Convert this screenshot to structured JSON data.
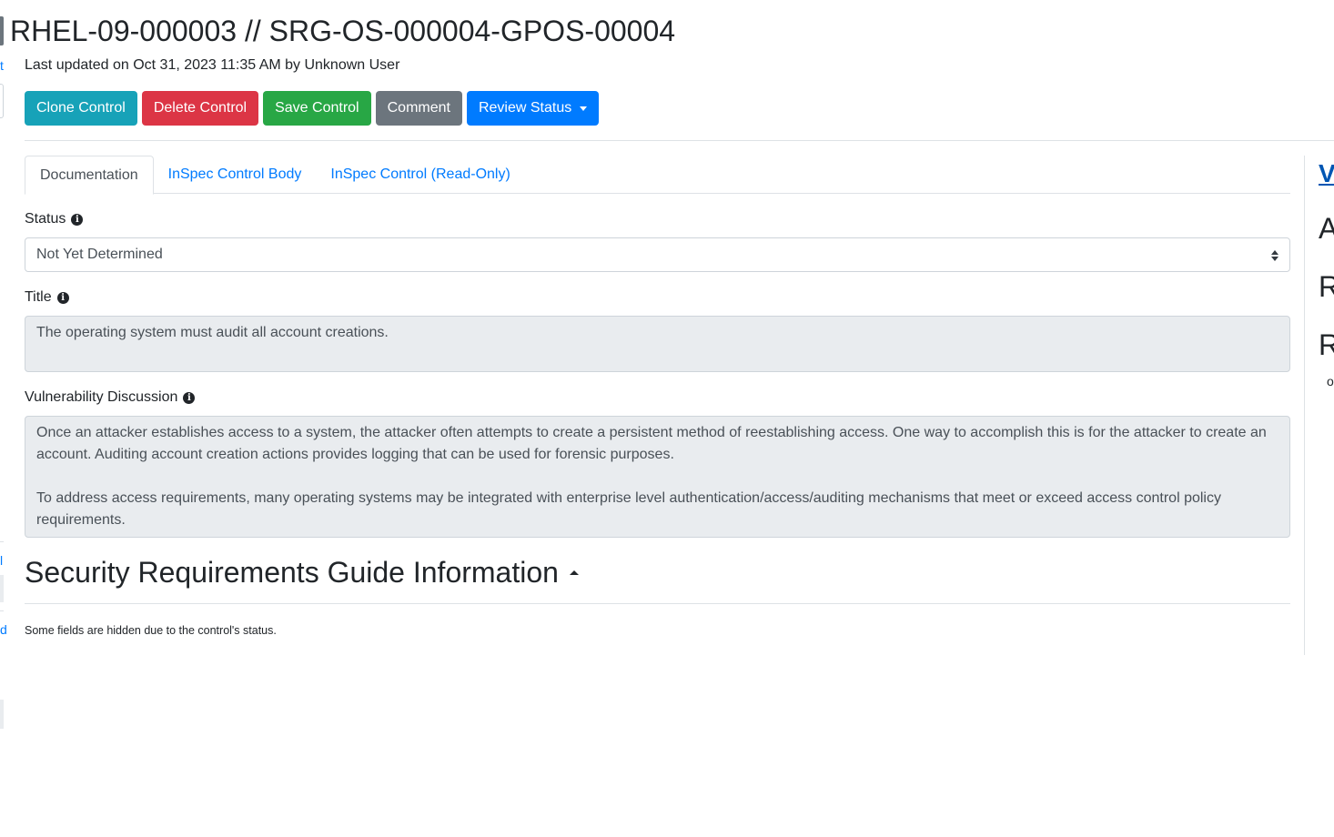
{
  "control": {
    "title": "RHEL-09-000003 // SRG-OS-000004-GPOS-00004",
    "updated": "Last updated on Oct 31, 2023 11:35 AM by Unknown User"
  },
  "actions": {
    "clone": "Clone Control",
    "delete": "Delete Control",
    "save": "Save Control",
    "comment": "Comment",
    "review": "Review Status"
  },
  "tabs": [
    {
      "label": "Documentation",
      "active": true
    },
    {
      "label": "InSpec Control Body",
      "active": false
    },
    {
      "label": "InSpec Control (Read-Only)",
      "active": false
    }
  ],
  "fields": {
    "status_label": "Status",
    "status_value": "Not Yet Determined",
    "title_label": "Title",
    "title_value": "The operating system must audit all account creations.",
    "vuln_label": "Vulnerability Discussion",
    "vuln_paragraphs": [
      "Once an attacker establishes access to a system, the attacker often attempts to create a persistent method of reestablishing access. One way to accomplish this is for the attacker to create an account. Auditing account creation actions provides logging that can be used for forensic purposes.",
      "To address access requirements, many operating systems may be integrated with enterprise level authentication/access/auditing mechanisms that meet or exceed access control policy requirements."
    ]
  },
  "srg": {
    "heading": "Security Requirements Guide Information",
    "note": "Some fields are hidden due to the control's status."
  },
  "left_edge": {
    "link_fragments": [
      "t",
      "l",
      "d"
    ]
  },
  "right_panel": {
    "link_fragment": "V",
    "heading_fragments": [
      "A",
      "R",
      "R"
    ],
    "small_fragment": "o"
  },
  "icons": {
    "info": "info-circle-icon",
    "select": "sort-icon",
    "dropdown": "caret-down-icon",
    "collapse": "caret-up-icon"
  }
}
